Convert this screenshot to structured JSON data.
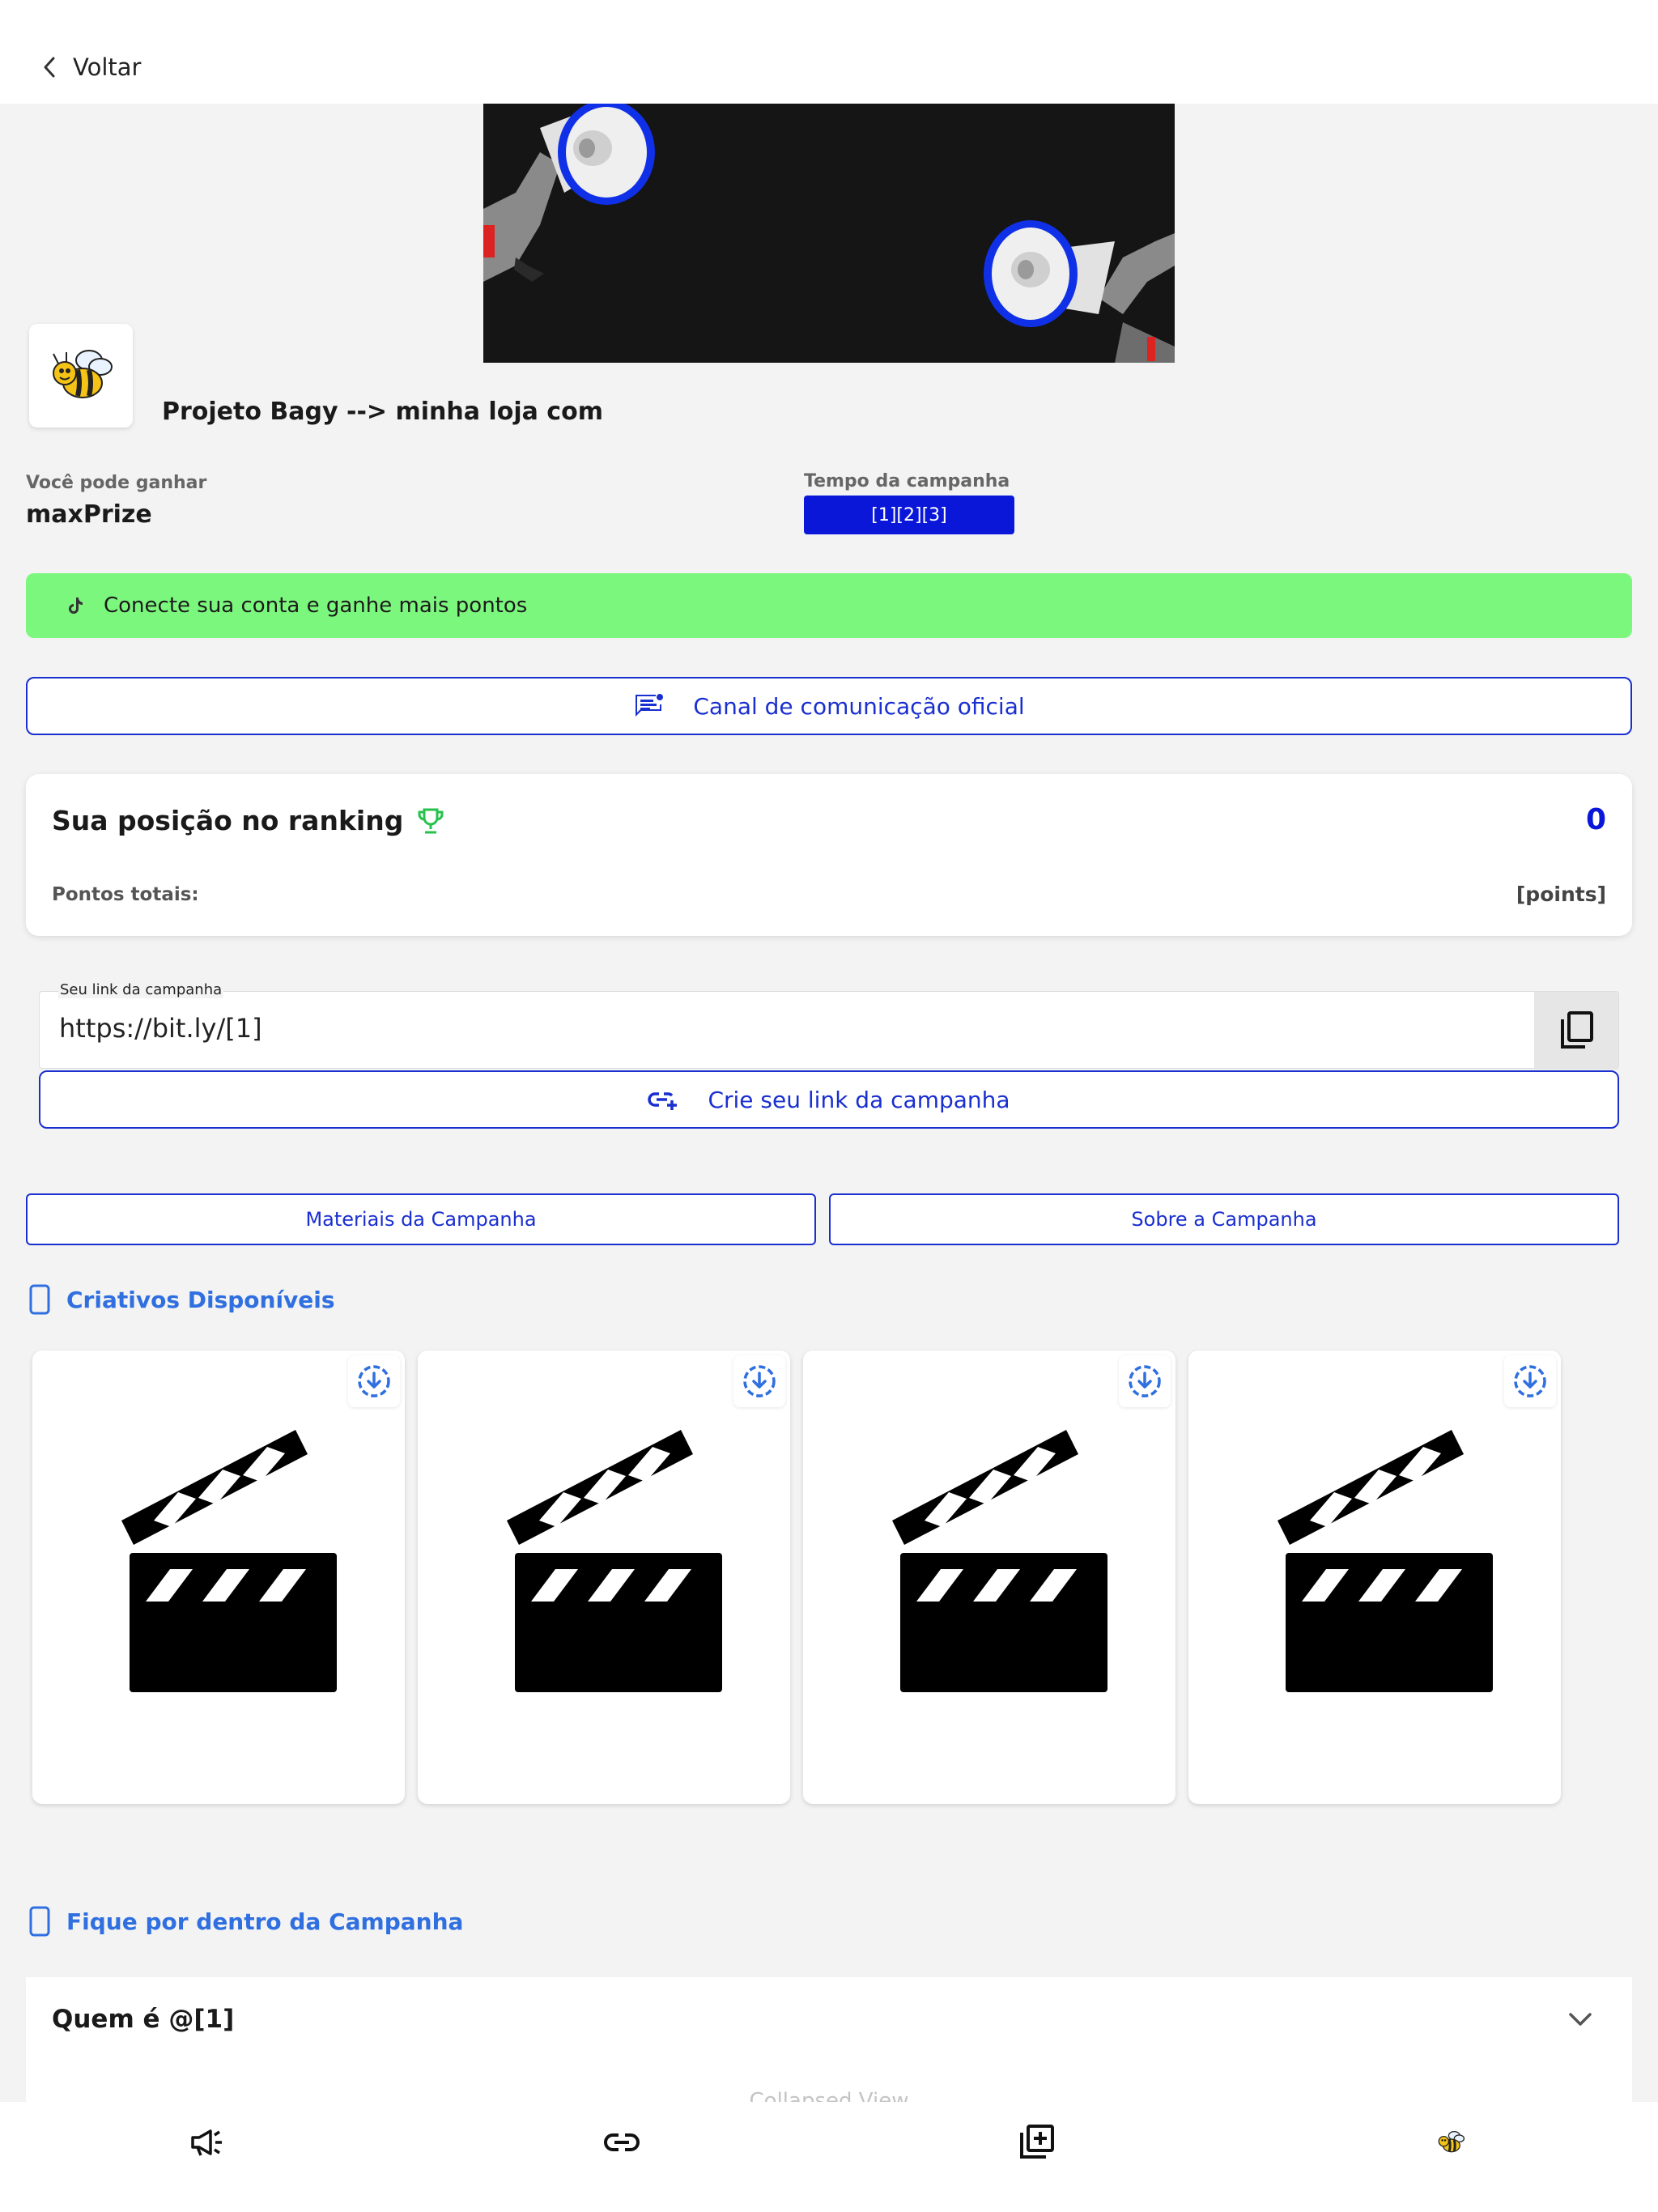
{
  "header": {
    "back_label": "Voltar"
  },
  "project": {
    "name": "Projeto Bagy --> minha loja com"
  },
  "prize": {
    "label": "Você pode ganhar",
    "value": "maxPrize"
  },
  "campaign_time": {
    "label": "Tempo da campanha",
    "value": "[1][2][3]"
  },
  "connect": {
    "label": "Conecte sua conta e ganhe mais pontos",
    "icon": "tiktok-icon"
  },
  "canal": {
    "label": "Canal de comunicação oficial",
    "icon": "announcement-icon"
  },
  "ranking": {
    "title": "Sua posição no ranking",
    "position": "0",
    "points_label": "Pontos totais:",
    "points_value": "[points]"
  },
  "campaign_link": {
    "label": "Seu link da campanha",
    "url": "https://bit.ly/[1]",
    "create_label": "Crie seu link da campanha"
  },
  "tabs": [
    {
      "label": "Materiais da Campanha"
    },
    {
      "label": "Sobre a Campanha"
    }
  ],
  "creatives": {
    "title": "Criativos Disponíveis",
    "items": [
      "video",
      "video",
      "video",
      "video"
    ]
  },
  "info": {
    "title": "Fique por dentro da Campanha",
    "question": "Quem é @[1]",
    "collapsed": "Collapsed View"
  },
  "nav": [
    "megaphone-icon",
    "link-icon",
    "add-box-icon",
    "bee-icon"
  ],
  "colors": {
    "primary": "#0a17d9",
    "accent_blue": "#2f6fe0",
    "connect_green": "#7cf77e",
    "trophy_green": "#27c24c"
  }
}
